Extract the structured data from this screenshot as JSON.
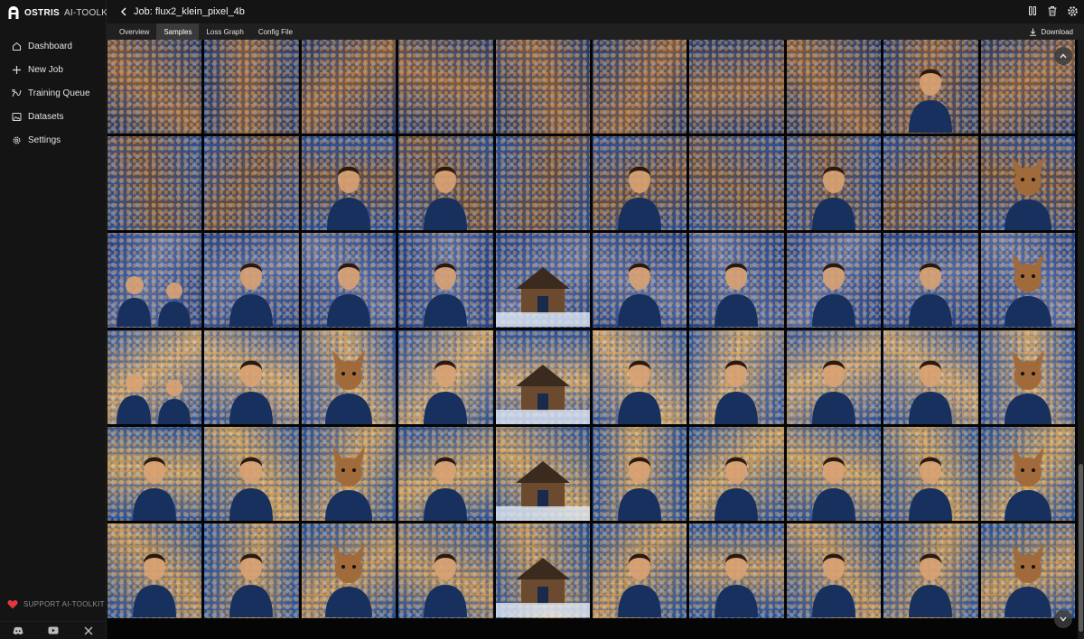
{
  "brand": {
    "name": "OSTRIS",
    "sub": "AI-TOOLKIT"
  },
  "nav": [
    {
      "label": "Dashboard",
      "icon": "home-icon"
    },
    {
      "label": "New Job",
      "icon": "plus-icon"
    },
    {
      "label": "Training Queue",
      "icon": "queue-icon"
    },
    {
      "label": "Datasets",
      "icon": "image-icon"
    },
    {
      "label": "Settings",
      "icon": "gear-icon"
    }
  ],
  "support": {
    "label": "SUPPORT AI-TOOLKIT",
    "heart_color": "#e0383e"
  },
  "socials": [
    "discord-icon",
    "youtube-icon",
    "x-icon"
  ],
  "header": {
    "title": "Job: flux2_klein_pixel_4b",
    "actions": [
      "pause-icon",
      "trash-icon",
      "gear-icon"
    ]
  },
  "tabs": [
    {
      "label": "Overview",
      "active": false
    },
    {
      "label": "Samples",
      "active": true
    },
    {
      "label": "Loss Graph",
      "active": false
    },
    {
      "label": "Config File",
      "active": false
    }
  ],
  "download_label": "Download",
  "samples": {
    "columns": 10,
    "rows": [
      {
        "palette": [
          "#7a4b2a",
          "#2b3e6e"
        ],
        "subjects": [
          "",
          "",
          "",
          "",
          "",
          "",
          "",
          "",
          "",
          ""
        ]
      },
      {
        "palette": [
          "#8a5a30",
          "#22365f"
        ],
        "subjects": [
          "",
          "",
          "",
          "",
          "",
          "",
          "",
          "",
          "person",
          ""
        ]
      },
      {
        "palette": [
          "#6c4a2d",
          "#284a8a"
        ],
        "subjects": [
          "",
          "",
          "person",
          "person",
          "",
          "person",
          "",
          "person",
          "",
          "animal"
        ]
      },
      {
        "palette": [
          "#5f6f9a",
          "#203c7a"
        ],
        "subjects": [
          "people",
          "person",
          "person",
          "person",
          "house",
          "person",
          "person",
          "person",
          "person",
          "animal"
        ]
      },
      {
        "palette": [
          "#c9a063",
          "#244d95"
        ],
        "subjects": [
          "people",
          "person",
          "animal",
          "person",
          "house",
          "person",
          "person",
          "person",
          "person",
          "animal"
        ]
      },
      {
        "palette": [
          "#c59a54",
          "#1f4a8f"
        ],
        "subjects": [
          "person",
          "person",
          "animal",
          "person",
          "house",
          "person",
          "person",
          "person",
          "person",
          "animal"
        ]
      },
      {
        "palette": [
          "#b98e50",
          "#1d4a90"
        ],
        "subjects": [
          "person",
          "person",
          "animal",
          "person",
          "house",
          "person",
          "person",
          "person",
          "person",
          "animal"
        ]
      }
    ]
  }
}
